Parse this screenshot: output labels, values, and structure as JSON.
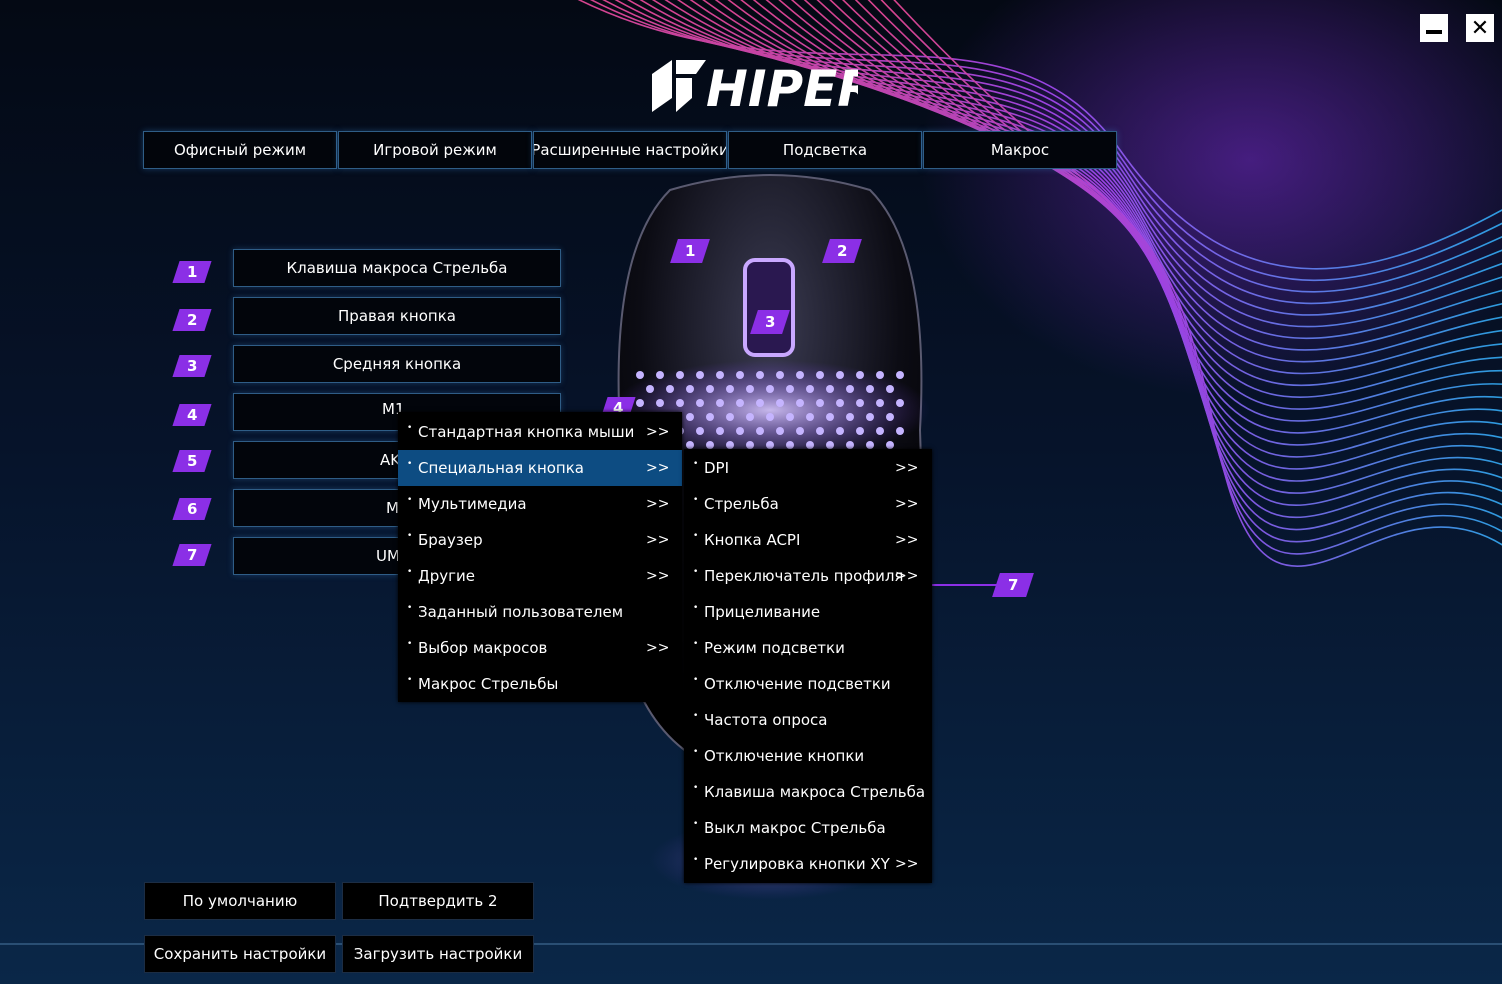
{
  "window": {
    "minimize_label": "—",
    "close_label": "✕"
  },
  "logo": {
    "text": "HIPER"
  },
  "tabs": [
    {
      "label": "Офисный режим"
    },
    {
      "label": "Игровой режим"
    },
    {
      "label": "Расширенные настройки"
    },
    {
      "label": "Подсветка"
    },
    {
      "label": "Макрос"
    }
  ],
  "buttons": [
    {
      "num": "1",
      "label": "Клавиша макроса Стрельба"
    },
    {
      "num": "2",
      "label": "Правая кнопка"
    },
    {
      "num": "3",
      "label": "Средняя кнопка"
    },
    {
      "num": "4",
      "label": "M1..."
    },
    {
      "num": "5",
      "label": "AK"
    },
    {
      "num": "6",
      "label": "M"
    },
    {
      "num": "7",
      "label": "UM"
    }
  ],
  "mouse_badges": [
    "1",
    "2",
    "3",
    "4",
    "7"
  ],
  "context_menu": {
    "bullet": "•",
    "submenu_arrow": ">>",
    "items": [
      {
        "label": "Стандартная кнопка мыши",
        "has_submenu": true
      },
      {
        "label": "Специальная кнопка",
        "has_submenu": true,
        "selected": true
      },
      {
        "label": "Мультимедиа",
        "has_submenu": true
      },
      {
        "label": "Браузер",
        "has_submenu": true
      },
      {
        "label": "Другие",
        "has_submenu": true
      },
      {
        "label": "Заданный пользователем",
        "has_submenu": false
      },
      {
        "label": "Выбор макросов",
        "has_submenu": true
      },
      {
        "label": "Макрос Стрельбы",
        "has_submenu": false
      }
    ]
  },
  "submenu": {
    "items": [
      {
        "label": "DPI",
        "has_submenu": true
      },
      {
        "label": "Стрельба",
        "has_submenu": true
      },
      {
        "label": "Кнопка ACPI",
        "has_submenu": true
      },
      {
        "label": "Переключатель профиля",
        "has_submenu": true
      },
      {
        "label": "Прицеливание",
        "has_submenu": false
      },
      {
        "label": "Режим подсветки",
        "has_submenu": false
      },
      {
        "label": "Отключение подсветки",
        "has_submenu": false
      },
      {
        "label": "Частота опроса",
        "has_submenu": false
      },
      {
        "label": "Отключение кнопки",
        "has_submenu": false
      },
      {
        "label": "Клавиша макроса Стрельба",
        "has_submenu": false
      },
      {
        "label": "Выкл макрос Стрельба",
        "has_submenu": false
      },
      {
        "label": "Регулировка кнопки XY",
        "has_submenu": true
      }
    ]
  },
  "bottom": {
    "default_label": "По умолчанию",
    "confirm_label": "Подтвердить 2",
    "save_label": "Сохранить настройки",
    "load_label": "Загрузить настройки"
  },
  "colors": {
    "accent": "#8b2fe6",
    "selection": "#0d4c82",
    "border": "#2f5d86"
  }
}
